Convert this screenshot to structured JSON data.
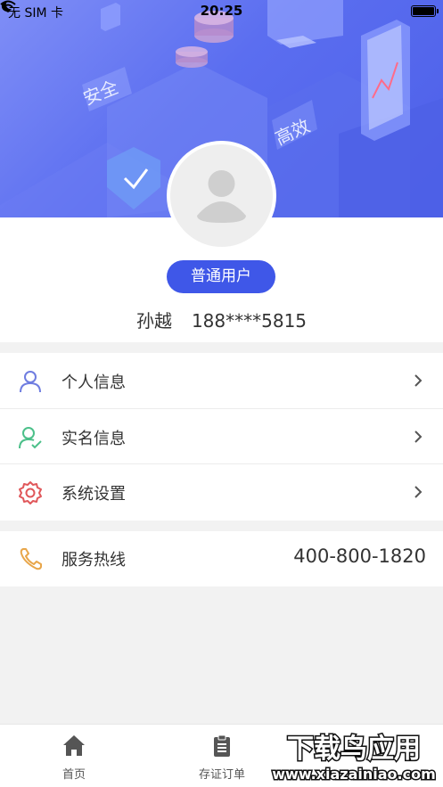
{
  "status_bar": {
    "carrier": "无 SIM 卡",
    "time": "20:25"
  },
  "hero": {
    "decor_text_1": "安全",
    "decor_text_2": "高效"
  },
  "profile": {
    "badge": "普通用户",
    "name": "孙越",
    "phone": "188****5815"
  },
  "menu": {
    "items": [
      {
        "label": "个人信息",
        "icon": "user-icon"
      },
      {
        "label": "实名信息",
        "icon": "user-verified-icon"
      },
      {
        "label": "系统设置",
        "icon": "gear-icon"
      }
    ]
  },
  "service": {
    "label": "服务热线",
    "phone": "400-800-1820",
    "icon": "phone-icon"
  },
  "tabbar": {
    "tabs": [
      {
        "label": "首页",
        "icon": "home-icon"
      },
      {
        "label": "存证订单",
        "icon": "clipboard-icon"
      }
    ]
  },
  "watermark": {
    "text": "下载鸟应用",
    "url": "www.xiazainiao.com"
  },
  "colors": {
    "accent": "#3f57e8",
    "hero_start": "#7f8ef6",
    "hero_end": "#4c5fe8",
    "user_icon": "#6f7de0",
    "verified_icon": "#4cc08a",
    "gear_icon": "#e0575a",
    "phone_icon": "#e8a64a"
  }
}
